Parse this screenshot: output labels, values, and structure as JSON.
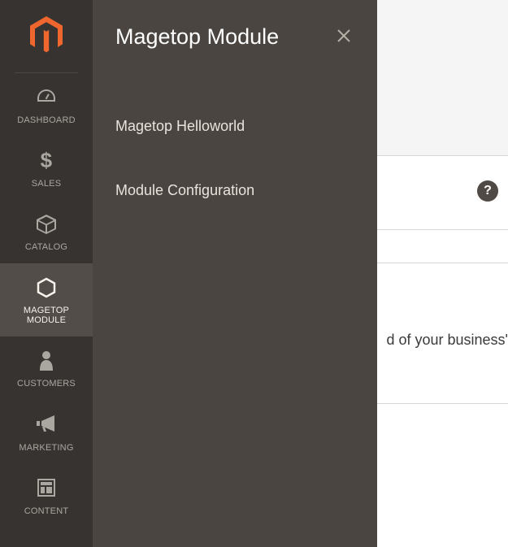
{
  "sidebar": {
    "items": [
      {
        "label": "DASHBOARD",
        "icon": "dashboard-icon"
      },
      {
        "label": "SALES",
        "icon": "dollar-icon"
      },
      {
        "label": "CATALOG",
        "icon": "cube-icon"
      },
      {
        "label": "MAGETOP MODULE",
        "icon": "hex-icon"
      },
      {
        "label": "CUSTOMERS",
        "icon": "person-icon"
      },
      {
        "label": "MARKETING",
        "icon": "megaphone-icon"
      },
      {
        "label": "CONTENT",
        "icon": "layout-icon"
      }
    ]
  },
  "flyout": {
    "title": "Magetop Module",
    "items": [
      {
        "label": "Magetop Helloworld"
      },
      {
        "label": "Module Configuration"
      }
    ]
  },
  "content": {
    "help_symbol": "?",
    "business_text": "d of your business'"
  },
  "colors": {
    "brand": "#ef672f",
    "sidebar_bg": "#373330",
    "flyout_bg": "#4a4540",
    "active_bg": "#524d49"
  }
}
